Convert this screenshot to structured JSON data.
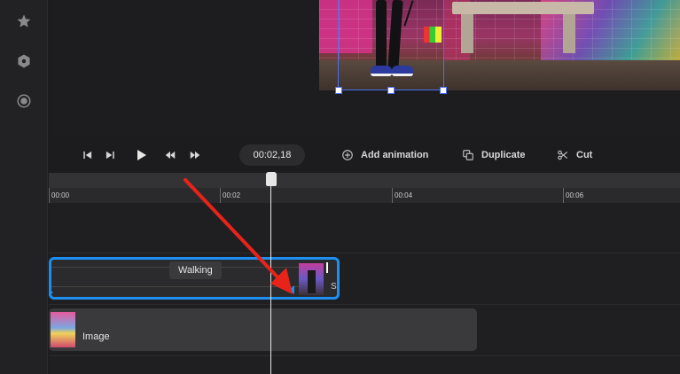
{
  "toolbar": {
    "timecode": "00:02,18",
    "add_animation_label": "Add animation",
    "duplicate_label": "Duplicate",
    "cut_label": "Cut"
  },
  "ruler": {
    "labels": [
      "00:00",
      "00:02",
      "00:04",
      "00:06"
    ]
  },
  "tracks": {
    "walking_clip_label": "Walking",
    "walking_clip_suffix": "S",
    "image_clip_label": "Image"
  },
  "colors": {
    "accent": "#1d8ff0",
    "selection": "#4c6ef5",
    "annotation_arrow": "#e8231a"
  },
  "icons": {
    "rail": [
      "star-icon",
      "hexagon-icon",
      "record-icon"
    ],
    "transport": [
      "skip-back-icon",
      "skip-forward-icon",
      "play-icon",
      "rewind-icon",
      "fast-forward-icon"
    ]
  }
}
